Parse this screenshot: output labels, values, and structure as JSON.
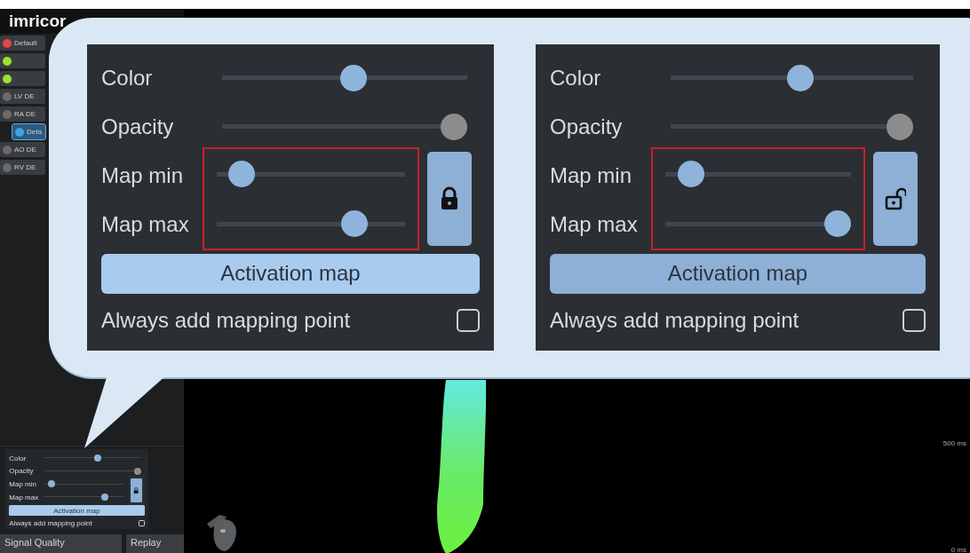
{
  "app": {
    "logo": "imricor"
  },
  "sidebar": {
    "items": [
      {
        "label": "Default",
        "color": "#e2484b",
        "selected": false
      },
      {
        "color": "#9de22c",
        "selected": false
      },
      {
        "color": "#9de22c",
        "selected": false
      },
      {
        "label": "LV DE",
        "color": "#6a6a6a",
        "selected": false
      },
      {
        "label": "RA DE",
        "color": "#6a6a6a",
        "selected": false,
        "children": [
          {
            "label": "Defa",
            "color": "#3fa3e0",
            "selected": true
          }
        ]
      },
      {
        "label": "AO DE",
        "color": "#6a6a6a",
        "selected": false
      },
      {
        "label": "RV DE",
        "color": "#6a6a6a",
        "selected": false
      }
    ]
  },
  "settings_panel": {
    "sliders": [
      {
        "label": "Color",
        "level": 0.55,
        "color": "#8fb4dc"
      },
      {
        "label": "Opacity",
        "level": 1.0,
        "color": "#8c8c8c"
      },
      {
        "label": "Map min",
        "level": 0.06,
        "color": "#8fb4dc"
      },
      {
        "label": "Map max",
        "level": 0.78,
        "color": "#8fb4dc"
      }
    ],
    "locked": true,
    "highlighted": false,
    "button": "Activation map",
    "hovered": true,
    "checkbox": {
      "label": "Always add mapping point",
      "checked": false
    }
  },
  "bottom_tabs": [
    {
      "label": "Signal Quality"
    },
    {
      "label": "Replay"
    }
  ],
  "viewport": {
    "scale_labels": [
      "500 ms",
      "0 ms"
    ]
  },
  "callout": {
    "panels": [
      {
        "sliders": [
          {
            "label": "Color",
            "level": 0.54,
            "color": "#8fb4dc"
          },
          {
            "label": "Opacity",
            "level": 1.0,
            "color": "#8c8c8c"
          },
          {
            "label": "Map min",
            "level": 0.07,
            "color": "#8fb4dc"
          },
          {
            "label": "Map max",
            "level": 0.77,
            "color": "#8fb4dc"
          }
        ],
        "locked": true,
        "highlighted": true,
        "button": "Activation map",
        "hovered": true,
        "checkbox": {
          "label": "Always add mapping point",
          "checked": false
        }
      },
      {
        "sliders": [
          {
            "label": "Color",
            "level": 0.54,
            "color": "#8fb4dc"
          },
          {
            "label": "Opacity",
            "level": 1.0,
            "color": "#8c8c8c"
          },
          {
            "label": "Map min",
            "level": 0.08,
            "color": "#8fb4dc"
          },
          {
            "label": "Map max",
            "level": 1.0,
            "color": "#8fb4dc"
          }
        ],
        "locked": false,
        "highlighted": true,
        "button": "Activation map",
        "hovered": false,
        "checkbox": {
          "label": "Always add mapping point",
          "checked": false
        }
      }
    ]
  }
}
